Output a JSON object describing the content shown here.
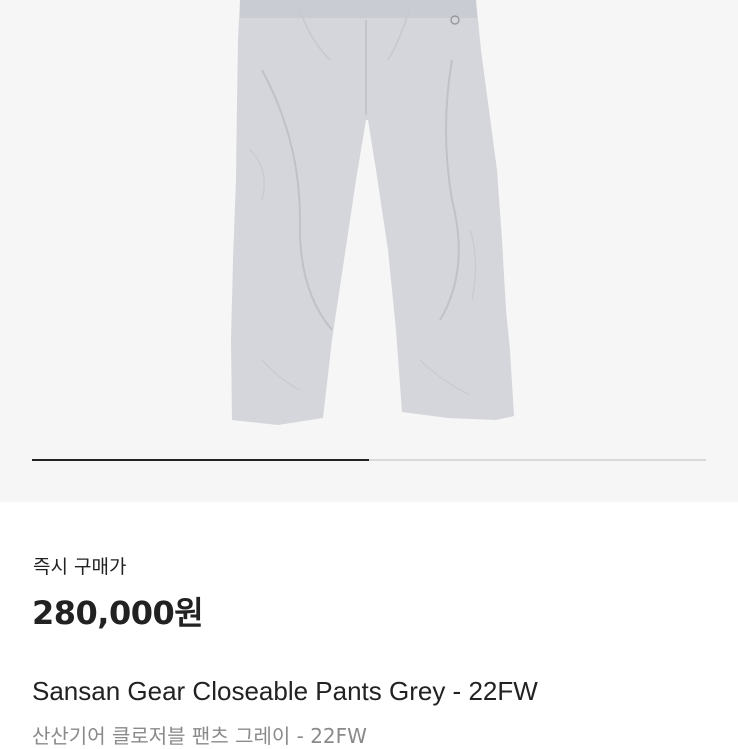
{
  "gallery": {
    "image": "grey-pants-photo",
    "progress": 0.5
  },
  "product": {
    "price_label": "즉시 구매가",
    "price": "280,000원",
    "title": "Sansan Gear Closeable Pants Grey - 22FW",
    "subtitle": "산산기어 클로저블 팬츠 그레이 - 22FW"
  },
  "colors": {
    "background": "#ffffff",
    "gallery_bg": "#f6f6f6",
    "pants": "#d4d6db",
    "text": "#222222",
    "subtext": "#8a8a8a"
  }
}
